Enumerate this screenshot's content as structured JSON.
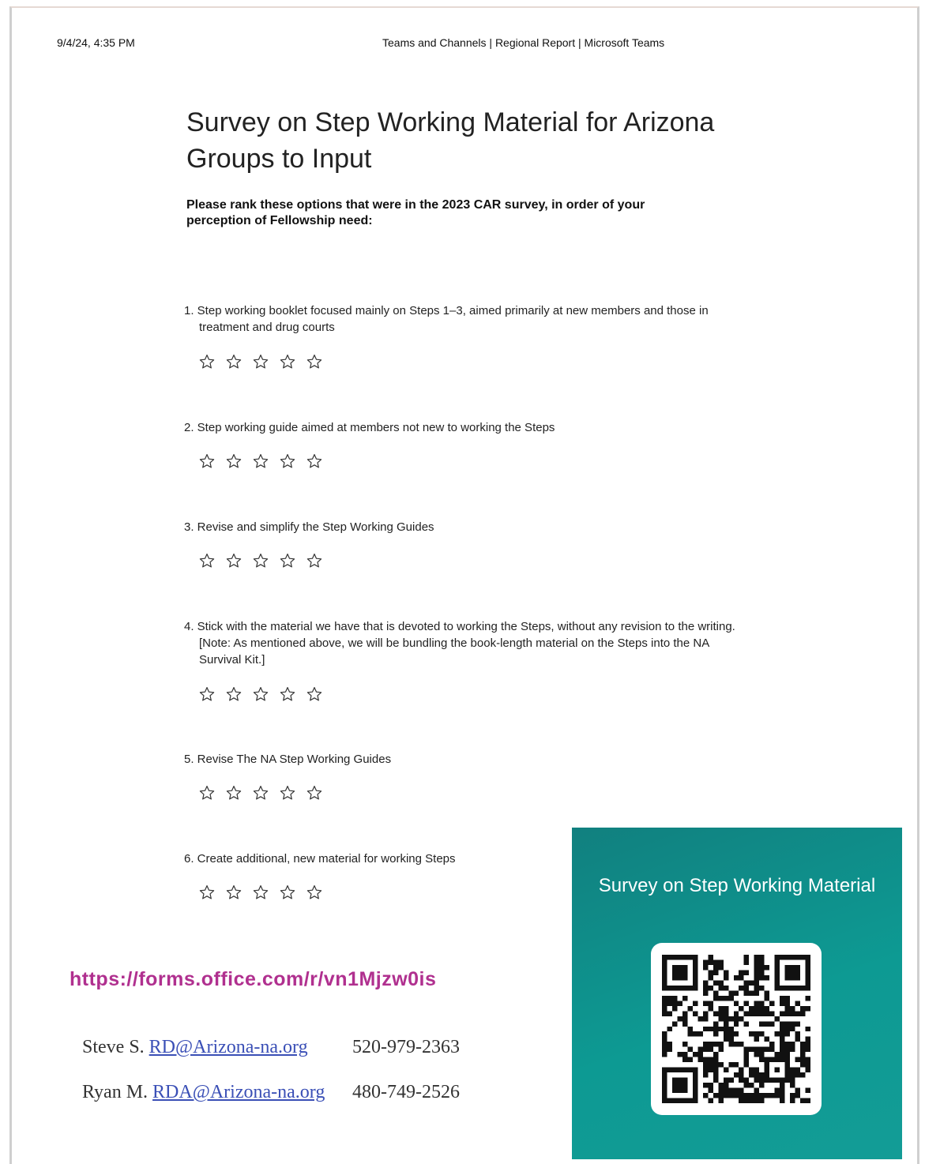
{
  "print_header": {
    "date": "9/4/24, 4:35 PM",
    "title": "Teams and Channels | Regional Report | Microsoft Teams"
  },
  "survey": {
    "title": "Survey on Step Working Material for Arizona Groups to Input",
    "instructions": "Please rank these options that were in the 2023 CAR survey, in order of your perception of Fellowship need:",
    "rating_icon": "star-outline-icon",
    "rating_max": 5,
    "questions": [
      "1. Step working booklet focused mainly on Steps 1–3, aimed primarily at new members and those in treatment and drug courts",
      "2. Step working guide aimed at members not new to working the Steps",
      "3. Revise and simplify the Step Working Guides",
      "4. Stick with the material we have that is devoted to working the Steps, without any revision to the writing. [Note: As mentioned above, we will be bundling the book-length material on the Steps into the NA Survival Kit.]",
      "5. Revise The NA Step Working Guides",
      "6. Create additional, new material for working Steps"
    ]
  },
  "footer": {
    "link": "https://forms.office.com/r/vn1Mjzw0is",
    "link_color": "#b0308f",
    "contacts": [
      {
        "name": "Steve S.",
        "email": "RD@Arizona-na.org",
        "phone": "520-979-2363"
      },
      {
        "name": "Ryan M.",
        "email": "RDA@Arizona-na.org",
        "phone": "480-749-2526"
      }
    ]
  },
  "qr_card": {
    "title": "Survey on Step Working Material",
    "background": "#0e8f8a",
    "icon": "qr-code-icon"
  }
}
